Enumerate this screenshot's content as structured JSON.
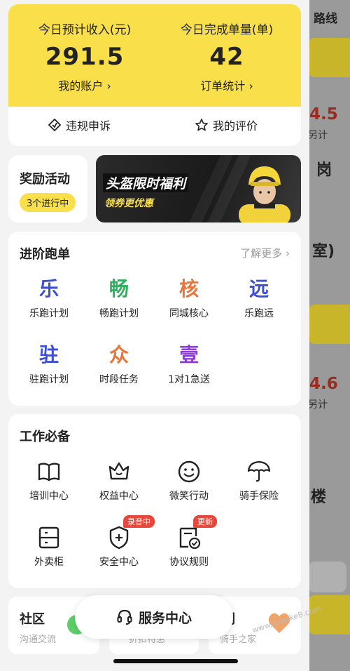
{
  "background": {
    "route_label": "路线",
    "texts": [
      "4.5",
      "另计",
      "岗",
      "室)",
      "4.6",
      "另计",
      "楼"
    ]
  },
  "income": {
    "left_label": "今日预计收入(元)",
    "left_value": "291.5",
    "left_link": "我的账户 ›",
    "right_label": "今日完成单量(单)",
    "right_value": "42",
    "right_link": "订单统计 ›",
    "action_appeal": "违规申诉",
    "action_rating": "我的评价"
  },
  "reward": {
    "title": "奖励活动",
    "badge": "3个进行中",
    "banner_title": "头盔限时福利",
    "banner_sub": "领券更优惠"
  },
  "advance": {
    "title": "进阶跑单",
    "more": "了解更多 ›",
    "items": [
      {
        "glyph": "乐",
        "name": "乐跑计划",
        "color": "#3d4fd6"
      },
      {
        "glyph": "畅",
        "name": "畅跑计划",
        "color": "#2fae5e"
      },
      {
        "glyph": "核",
        "name": "同城核心",
        "color": "#e8763a"
      },
      {
        "glyph": "远",
        "name": "乐跑远",
        "color": "#3d4fd6"
      },
      {
        "glyph": "驻",
        "name": "驻跑计划",
        "color": "#3d4fd6"
      },
      {
        "glyph": "众",
        "name": "时段任务",
        "color": "#e8763a"
      },
      {
        "glyph": "壹",
        "name": "1对1急送",
        "color": "#8a3ed6"
      }
    ]
  },
  "work": {
    "title": "工作必备",
    "items": [
      {
        "name": "培训中心",
        "icon": "book-icon"
      },
      {
        "name": "权益中心",
        "icon": "crown-icon"
      },
      {
        "name": "微笑行动",
        "icon": "smile-icon"
      },
      {
        "name": "骑手保险",
        "icon": "umbrella-icon"
      },
      {
        "name": "外卖柜",
        "icon": "locker-icon"
      },
      {
        "name": "安全中心",
        "icon": "shield-plus-icon",
        "tag": "录音中"
      },
      {
        "name": "协议规则",
        "icon": "document-check-icon",
        "tag": "更新"
      }
    ]
  },
  "bottom": {
    "community_title": "社区",
    "community_sub": "沟通交流",
    "middle_sub": "折扣特惠",
    "right_title": "利",
    "right_sub": "骑手之家",
    "service_center": "服务中心"
  },
  "watermark": "www.zuanke8.com"
}
